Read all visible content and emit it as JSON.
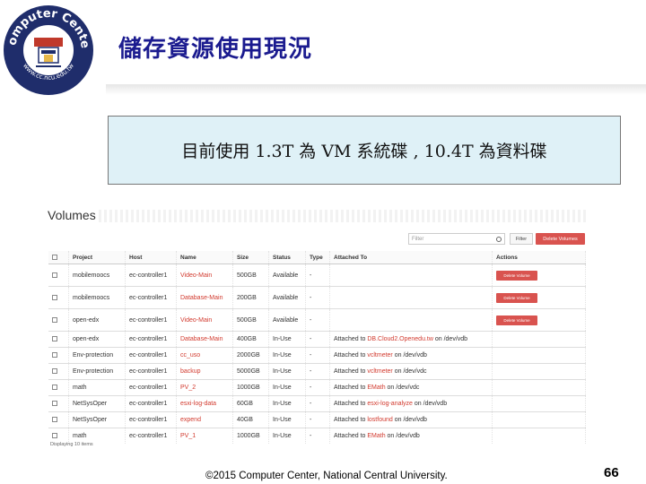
{
  "logo": {
    "ring_top_text": "Computer Center",
    "ring_bottom_text": "www.cc.ncu.edu.tw",
    "colors": {
      "ring": "#1f2d6b",
      "inner": "#ffffff",
      "accent": "#c0392b"
    }
  },
  "slide": {
    "title": "儲存資源使用現況",
    "callout": "目前使用 1.3T 為 VM 系統碟 , 10.4T 為資料碟",
    "footer": "©2015 Computer Center, National Central University.",
    "page_number": "66"
  },
  "screenshot": {
    "heading": "Volumes",
    "filter_placeholder": "Filter",
    "filter_button": "Filter",
    "delete_volumes_button": "Delete Volumes",
    "columns": [
      "Project",
      "Host",
      "Name",
      "Size",
      "Status",
      "Type",
      "Attached To",
      "Actions"
    ],
    "rows": [
      {
        "project": "mobilemoocs",
        "host": "ec-controller1",
        "name": "Video-Main",
        "size": "500GB",
        "status": "Available",
        "type": "-",
        "attached": "",
        "attached_link": "",
        "attached_suffix": "",
        "action": "Delete Volume"
      },
      {
        "project": "mobilemoocs",
        "host": "ec-controller1",
        "name": "Database-Main",
        "size": "200GB",
        "status": "Available",
        "type": "-",
        "attached": "",
        "attached_link": "",
        "attached_suffix": "",
        "action": "Delete Volume"
      },
      {
        "project": "open-edx",
        "host": "ec-controller1",
        "name": "Video-Main",
        "size": "500GB",
        "status": "Available",
        "type": "-",
        "attached": "",
        "attached_link": "",
        "attached_suffix": "",
        "action": "Delete Volume"
      },
      {
        "project": "open-edx",
        "host": "ec-controller1",
        "name": "Database-Main",
        "size": "400GB",
        "status": "In-Use",
        "type": "-",
        "attached": "Attached to ",
        "attached_link": "DB.Cloud2.Openedu.tw",
        "attached_suffix": " on /dev/vdb",
        "action": ""
      },
      {
        "project": "Env-protection",
        "host": "ec-controller1",
        "name": "cc_uso",
        "size": "2000GB",
        "status": "In-Use",
        "type": "-",
        "attached": "Attached to ",
        "attached_link": "vcltmeter",
        "attached_suffix": " on /dev/vdb",
        "action": ""
      },
      {
        "project": "Env-protection",
        "host": "ec-controller1",
        "name": "backup",
        "size": "5000GB",
        "status": "In-Use",
        "type": "-",
        "attached": "Attached to ",
        "attached_link": "vcltmeter",
        "attached_suffix": " on /dev/vdc",
        "action": ""
      },
      {
        "project": "math",
        "host": "ec-controller1",
        "name": "PV_2",
        "size": "1000GB",
        "status": "In-Use",
        "type": "-",
        "attached": "Attached to ",
        "attached_link": "EMath",
        "attached_suffix": " on /dev/vdc",
        "action": ""
      },
      {
        "project": "NetSysOper",
        "host": "ec-controller1",
        "name": "esxi-log-data",
        "size": "60GB",
        "status": "In-Use",
        "type": "-",
        "attached": "Attached to ",
        "attached_link": "esxi-log-analyze",
        "attached_suffix": " on /dev/vdb",
        "action": ""
      },
      {
        "project": "NetSysOper",
        "host": "ec-controller1",
        "name": "expend",
        "size": "40GB",
        "status": "In-Use",
        "type": "-",
        "attached": "Attached to ",
        "attached_link": "lostfound",
        "attached_suffix": " on /dev/vdb",
        "action": ""
      },
      {
        "project": "math",
        "host": "ec-controller1",
        "name": "PV_1",
        "size": "1000GB",
        "status": "In-Use",
        "type": "-",
        "attached": "Attached to ",
        "attached_link": "EMath",
        "attached_suffix": " on /dev/vdb",
        "action": ""
      }
    ],
    "displaying": "Displaying 10 items"
  }
}
